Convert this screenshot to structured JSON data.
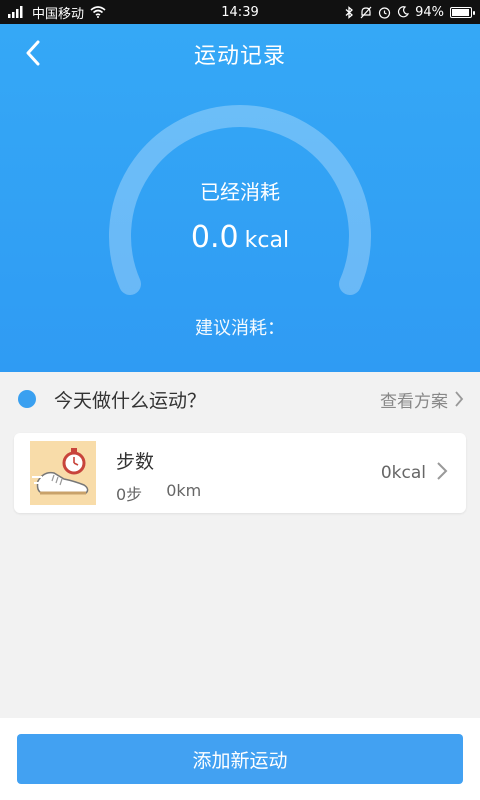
{
  "status_bar": {
    "carrier": "中国移动",
    "time": "14:39",
    "battery": "94%",
    "battery_level": 0.94
  },
  "header": {
    "title": "运动记录",
    "consumed_label": "已经消耗",
    "consumed_value": "0.0",
    "consumed_unit": "kcal",
    "suggest_label": "建议消耗："
  },
  "section": {
    "title": "今天做什么运动？",
    "view_plan": "查看方案"
  },
  "activity": {
    "name": "步数",
    "steps": "0步",
    "distance": "0km",
    "kcal": "0kcal"
  },
  "actions": {
    "add_label": "添加新运动"
  },
  "colors": {
    "header_blue": "#35a8f6",
    "button_blue": "#42a1f2",
    "dot_blue": "#3aa0f0"
  },
  "icons": [
    "signal-icon",
    "wifi-icon",
    "bluetooth-icon",
    "mute-icon",
    "alarm-icon",
    "moon-icon",
    "battery-icon",
    "back-arrow-icon",
    "chevron-right-icon",
    "running-shoe-icon",
    "stopwatch-icon"
  ]
}
